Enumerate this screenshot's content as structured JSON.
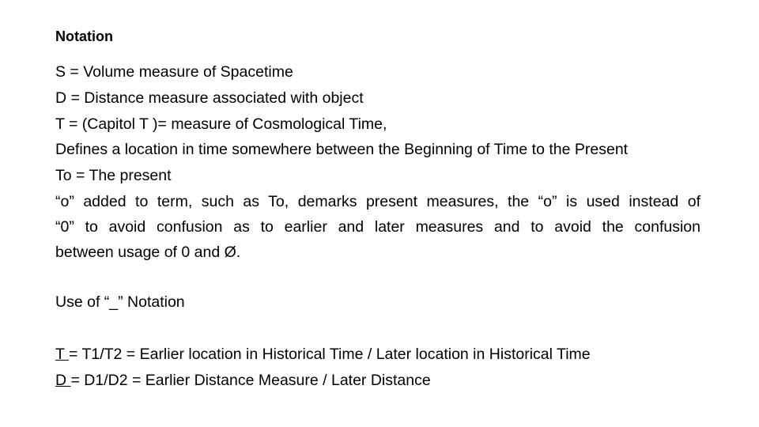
{
  "heading": "Notation",
  "definitions": [
    "S = Volume measure of Spacetime",
    "D = Distance measure associated with object",
    "T = (Capitol T )= measure of Cosmological Time,",
    "Defines a location in time somewhere between the Beginning of Time to the Present",
    "To = The present"
  ],
  "paragraph_lines": [
    "“o” added to term, such as To, demarks present measures, the “o” is used instead of",
    "“0” to avoid confusion as to earlier and later measures and to avoid the confusion",
    "between usage of 0 and Ø."
  ],
  "subheading": "Use of “_” Notation",
  "ratio_definitions": [
    {
      "symbol": "T ",
      "rest": "= T1/T2 = Earlier location in  Historical Time / Later location in Historical Time"
    },
    {
      "symbol": "D ",
      "rest": "= D1/D2 = Earlier Distance Measure / Later Distance"
    }
  ]
}
